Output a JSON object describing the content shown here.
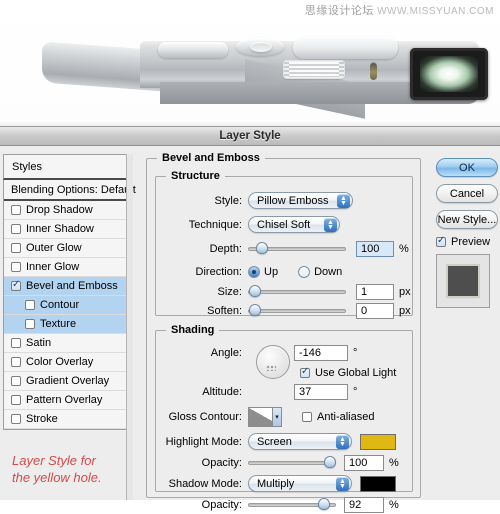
{
  "watermark": {
    "cn": "思缘设计论坛",
    "en": "WWW.MISSYUAN.COM"
  },
  "photo": {
    "alt": "silver compact camera side profile"
  },
  "dialog": {
    "title": "Layer Style"
  },
  "styles_panel": {
    "header": "Styles",
    "blending_options": "Blending Options: Default",
    "effects": [
      {
        "label": "Drop Shadow",
        "checked": false,
        "sub": false,
        "selected": false
      },
      {
        "label": "Inner Shadow",
        "checked": false,
        "sub": false,
        "selected": false
      },
      {
        "label": "Outer Glow",
        "checked": false,
        "sub": false,
        "selected": false
      },
      {
        "label": "Inner Glow",
        "checked": false,
        "sub": false,
        "selected": false
      },
      {
        "label": "Bevel and Emboss",
        "checked": true,
        "sub": false,
        "selected": true
      },
      {
        "label": "Contour",
        "checked": false,
        "sub": true,
        "selected": true
      },
      {
        "label": "Texture",
        "checked": false,
        "sub": true,
        "selected": true
      },
      {
        "label": "Satin",
        "checked": false,
        "sub": false,
        "selected": false
      },
      {
        "label": "Color Overlay",
        "checked": false,
        "sub": false,
        "selected": false
      },
      {
        "label": "Gradient Overlay",
        "checked": false,
        "sub": false,
        "selected": false
      },
      {
        "label": "Pattern Overlay",
        "checked": false,
        "sub": false,
        "selected": false
      },
      {
        "label": "Stroke",
        "checked": false,
        "sub": false,
        "selected": false
      }
    ],
    "annotation_line1": "Layer Style for",
    "annotation_line2": "the yellow hole.",
    "annotation_color": "#d24b4b"
  },
  "bevel": {
    "group_label": "Bevel and Emboss",
    "structure": {
      "group_label": "Structure",
      "style_label": "Style:",
      "style_value": "Pillow Emboss",
      "technique_label": "Technique:",
      "technique_value": "Chisel Soft",
      "depth_label": "Depth:",
      "depth_value": "100",
      "depth_unit": "%",
      "depth_percent": 9,
      "direction_label": "Direction:",
      "direction_up": "Up",
      "direction_down": "Down",
      "direction_selected": "Up",
      "size_label": "Size:",
      "size_value": "1",
      "size_unit": "px",
      "size_percent": 1,
      "soften_label": "Soften:",
      "soften_value": "0",
      "soften_unit": "px",
      "soften_percent": 1
    },
    "shading": {
      "group_label": "Shading",
      "angle_label": "Angle:",
      "angle_value": "-146",
      "angle_unit": "°",
      "use_global_light": "Use Global Light",
      "use_global_light_checked": true,
      "altitude_label": "Altitude:",
      "altitude_value": "37",
      "altitude_unit": "°",
      "gloss_contour_label": "Gloss Contour:",
      "anti_aliased": "Anti-aliased",
      "anti_aliased_checked": false,
      "highlight_mode_label": "Highlight Mode:",
      "highlight_mode_value": "Screen",
      "highlight_color": "#E0B814",
      "highlight_opacity_label": "Opacity:",
      "highlight_opacity_value": "100",
      "highlight_opacity_unit": "%",
      "highlight_opacity_percent": 100,
      "shadow_mode_label": "Shadow Mode:",
      "shadow_mode_value": "Multiply",
      "shadow_color": "#000000",
      "shadow_opacity_label": "Opacity:",
      "shadow_opacity_value": "92",
      "shadow_opacity_unit": "%",
      "shadow_opacity_percent": 92
    }
  },
  "buttons": {
    "ok": "OK",
    "cancel": "Cancel",
    "new_style": "New Style...",
    "preview": "Preview",
    "preview_checked": true,
    "thumb_color": "#4e4e4e"
  }
}
